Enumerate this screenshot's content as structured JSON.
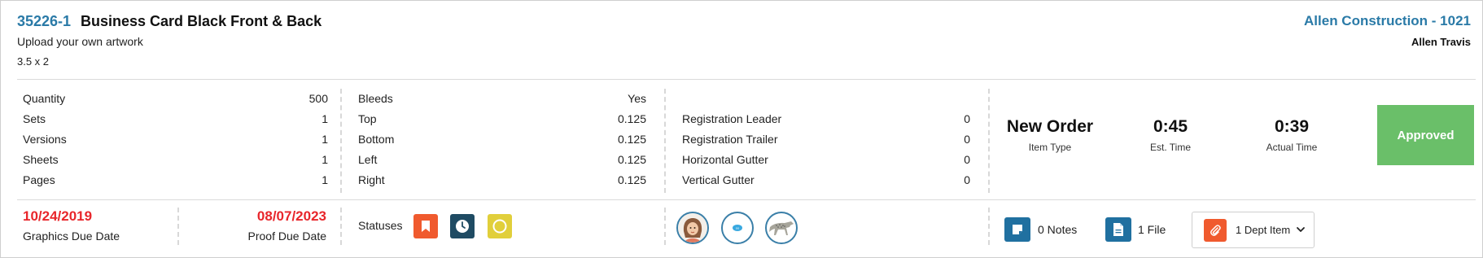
{
  "header": {
    "item_number": "35226-1",
    "item_title": "Business Card Black Front & Back",
    "description": "Upload your own artwork",
    "size": "3.5 x 2",
    "customer": "Allen Construction - 1021",
    "contact": "Allen Travis"
  },
  "quantities": [
    {
      "label": "Quantity",
      "value": "500"
    },
    {
      "label": "Sets",
      "value": "1"
    },
    {
      "label": "Versions",
      "value": "1"
    },
    {
      "label": "Sheets",
      "value": "1"
    },
    {
      "label": "Pages",
      "value": "1"
    }
  ],
  "bleeds": [
    {
      "label": "Bleeds",
      "value": "Yes"
    },
    {
      "label": "Top",
      "value": "0.125"
    },
    {
      "label": "Bottom",
      "value": "0.125"
    },
    {
      "label": "Left",
      "value": "0.125"
    },
    {
      "label": "Right",
      "value": "0.125"
    }
  ],
  "registration": [
    {
      "label": "Registration Leader",
      "value": "0"
    },
    {
      "label": "Registration Trailer",
      "value": "0"
    },
    {
      "label": "Horizontal Gutter",
      "value": "0"
    },
    {
      "label": "Vertical Gutter",
      "value": "0"
    }
  ],
  "stats": {
    "item_type_value": "New Order",
    "item_type_label": "Item Type",
    "est_time_value": "0:45",
    "est_time_label": "Est. Time",
    "actual_time_value": "0:39",
    "actual_time_label": "Actual Time"
  },
  "approval": {
    "label": "Approved",
    "color": "#6abf69"
  },
  "dates": {
    "graphics_due_value": "10/24/2019",
    "graphics_due_label": "Graphics Due Date",
    "proof_due_value": "08/07/2023",
    "proof_due_label": "Proof Due Date"
  },
  "statuses": {
    "label": "Statuses",
    "icons": [
      {
        "name": "bookmark-icon",
        "color": "#f05a2e"
      },
      {
        "name": "clock-icon",
        "color": "#1f4b63"
      },
      {
        "name": "circle-progress-icon",
        "color": "#e1cf3b"
      }
    ]
  },
  "assignees": [
    {
      "name": "avatar-woman"
    },
    {
      "name": "avatar-logo"
    },
    {
      "name": "avatar-cheetah"
    }
  ],
  "counts": {
    "notes_label": "0 Notes",
    "files_label": "1 File",
    "dept_label": "1 Dept Item"
  },
  "colors": {
    "accent_blue": "#2a7aa7",
    "due_red": "#e8262b",
    "icon_blue": "#2070a0",
    "dept_orange": "#f05a2e"
  }
}
